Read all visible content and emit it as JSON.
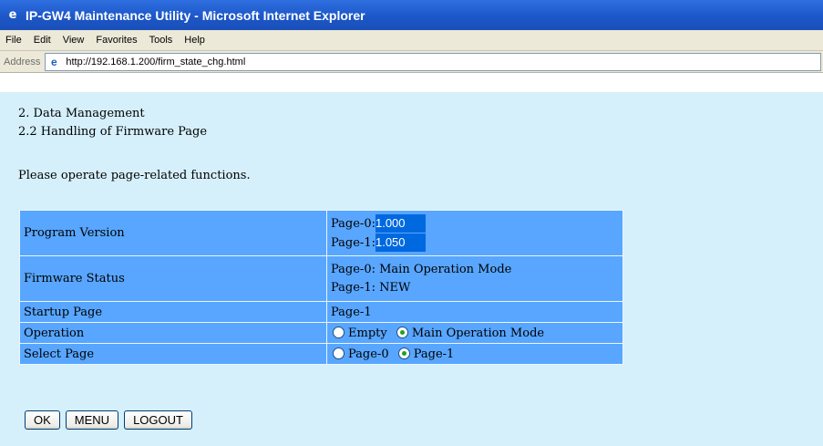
{
  "window": {
    "title": "IP-GW4 Maintenance Utility - Microsoft Internet Explorer"
  },
  "menu": [
    "File",
    "Edit",
    "View",
    "Favorites",
    "Tools",
    "Help"
  ],
  "address": {
    "label": "Address",
    "url": "http://192.168.1.200/firm_state_chg.html"
  },
  "page": {
    "heading1": "2. Data Management",
    "heading2": "2.2 Handling of Firmware Page",
    "instruction": "Please operate page-related functions.",
    "rows": {
      "program_version": {
        "label": "Program Version",
        "page0_prefix": "Page-0:",
        "page0_value": "1.000",
        "page1_prefix": "Page-1:",
        "page1_value": "1.050"
      },
      "firmware_status": {
        "label": "Firmware Status",
        "page0": "Page-0: Main Operation Mode",
        "page1": "Page-1: NEW"
      },
      "startup_page": {
        "label": "Startup Page",
        "value": "Page-1"
      },
      "operation": {
        "label": "Operation",
        "options": [
          "Empty",
          "Main Operation Mode"
        ],
        "selected": "Main Operation Mode"
      },
      "select_page": {
        "label": "Select Page",
        "options": [
          "Page-0",
          "Page-1"
        ],
        "selected": "Page-1"
      }
    },
    "buttons": {
      "ok": "OK",
      "menu": "MENU",
      "logout": "LOGOUT"
    }
  }
}
